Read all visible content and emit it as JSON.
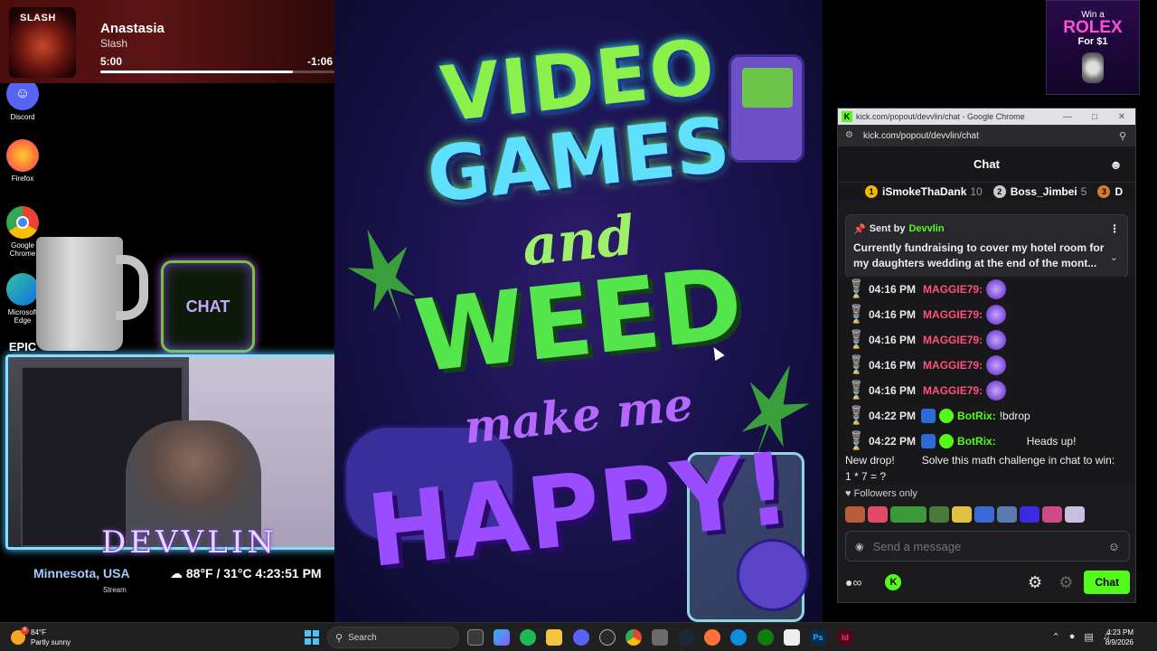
{
  "desktop": {
    "icons": [
      {
        "label": "Discord",
        "icon": "discord-icon",
        "color": "#5865f2"
      },
      {
        "label": "Firefox",
        "icon": "firefox-icon",
        "color": "#ff7139"
      },
      {
        "label": "Google Chrome",
        "icon": "chrome-icon",
        "color": "#4285f4"
      },
      {
        "label": "Microsoft Edge",
        "icon": "edge-icon",
        "color": "#0c8ee0"
      },
      {
        "label": "EPIC",
        "icon": "epic-games-icon",
        "color": "#2a2a2a"
      }
    ]
  },
  "now_playing": {
    "album_label": "SLASH",
    "title": "Anastasia",
    "artist": "Slash",
    "elapsed": "5:00",
    "remaining": "-1:06",
    "progress_fraction": 0.82
  },
  "overlay": {
    "chat_art_text": "CHAT",
    "streamer_name": "DEVVLIN",
    "location": "Minnesota, USA",
    "weather": "☁ 88°F / 31°C 4:23:51 PM",
    "stream_label": "Stream"
  },
  "poster": {
    "line1": "VIDEO",
    "line2": "GAMES",
    "line3": "and",
    "line4": "WEED",
    "line5": "make me",
    "line6": "HAPPY!"
  },
  "ad": {
    "top": "Win a",
    "brand": "ROLEX",
    "price": "For $1"
  },
  "chrome": {
    "window_title": "kick.com/popout/devvlin/chat - Google Chrome",
    "url": "kick.com/popout/devvlin/chat"
  },
  "chat": {
    "header": "Chat",
    "leaderboard": [
      {
        "rank": "1",
        "name": "iSmokeThaDank",
        "count": "10",
        "color": "#f5b800"
      },
      {
        "rank": "2",
        "name": "Boss_Jimbei",
        "count": "5",
        "color": "#c9c9c9"
      },
      {
        "rank": "3",
        "name": "D",
        "count": "",
        "color": "#cd7f32"
      }
    ],
    "pinned": {
      "sent_by_label": "Sent by",
      "sender": "Devvlin",
      "text": "Currently fundraising to cover my hotel room for my daughters wedding at the end of the mont..."
    },
    "messages": [
      {
        "time": "04:16 PM",
        "user": "MAGGIE79:",
        "color": "#ff4f7a"
      },
      {
        "time": "04:16 PM",
        "user": "MAGGIE79:",
        "color": "#ff4f7a"
      },
      {
        "time": "04:16 PM",
        "user": "MAGGIE79:",
        "color": "#ff4f7a"
      },
      {
        "time": "04:16 PM",
        "user": "MAGGIE79:",
        "color": "#ff4f7a"
      },
      {
        "time": "04:16 PM",
        "user": "MAGGIE79:",
        "color": "#ff4f7a"
      }
    ],
    "bot_msg_1": {
      "time": "04:22 PM",
      "user": "BotRix:",
      "text": "!bdrop",
      "color": "#53fc18"
    },
    "bot_msg_2": {
      "time": "04:22 PM",
      "user": "BotRix:",
      "text": "Heads up!",
      "continuation": "New drop!         Solve this math challenge in chat to win: 1 * 7 = ?",
      "color": "#53fc18"
    },
    "followers_only": "Followers only",
    "composer_placeholder": "Send a message",
    "send_label": "Chat"
  },
  "taskbar": {
    "temp": "84°F",
    "condition": "Partly sunny",
    "weather_badge": "6",
    "search_label": "Search",
    "time": "4:23 PM",
    "date": "8/9/2026"
  }
}
